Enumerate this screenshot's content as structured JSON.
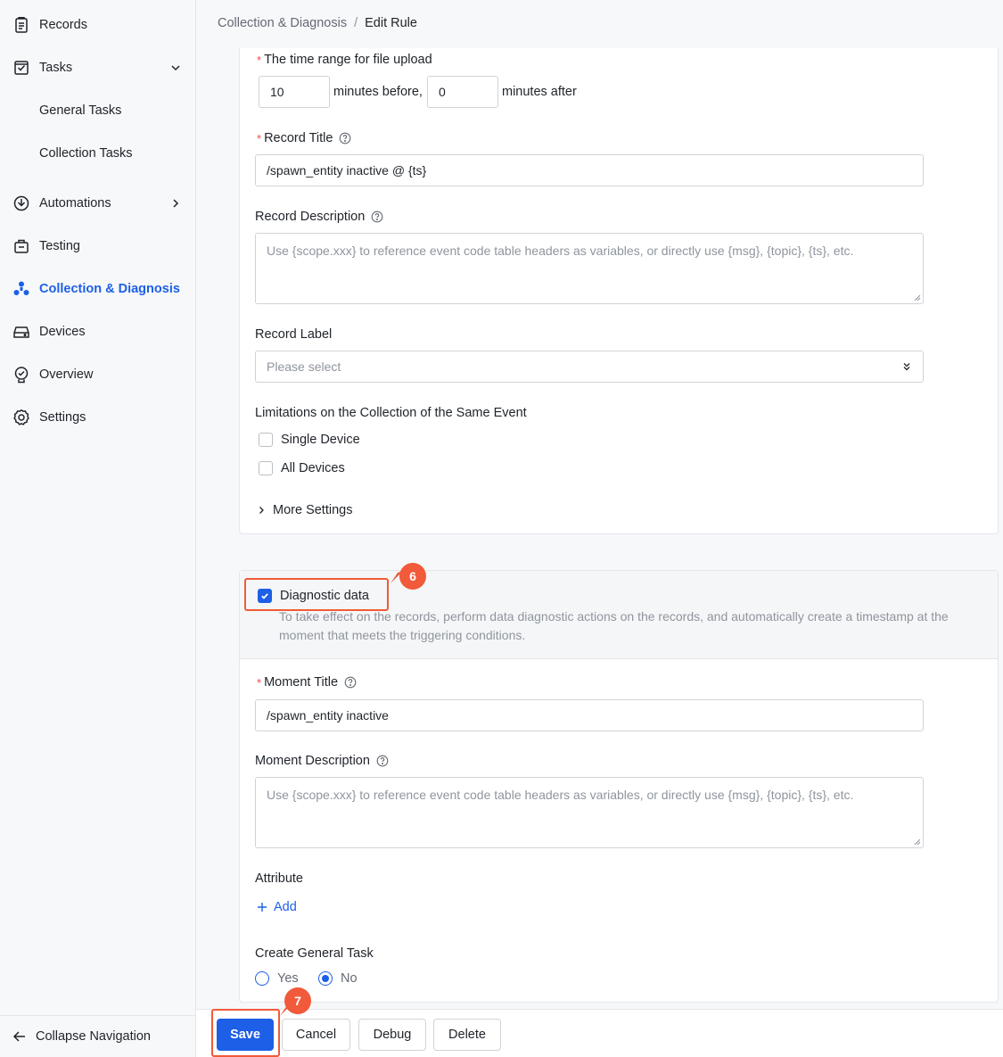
{
  "sidebar": {
    "items": [
      {
        "label": "Records",
        "icon": "records-icon"
      },
      {
        "label": "Tasks",
        "icon": "tasks-icon"
      },
      {
        "label": "General Tasks"
      },
      {
        "label": "Collection Tasks"
      },
      {
        "label": "Automations",
        "icon": "automations-icon"
      },
      {
        "label": "Testing",
        "icon": "testing-icon"
      },
      {
        "label": "Collection & Diagnosis",
        "icon": "collection-diagnosis-icon"
      },
      {
        "label": "Devices",
        "icon": "devices-icon"
      },
      {
        "label": "Overview",
        "icon": "overview-icon"
      },
      {
        "label": "Settings",
        "icon": "settings-icon"
      }
    ],
    "active_color": "#1d5fe6",
    "collapse_label": "Collapse Navigation"
  },
  "breadcrumb": {
    "parent": "Collection & Diagnosis",
    "separator": "/",
    "current": "Edit Rule"
  },
  "upload_range": {
    "label": "The time range for file upload",
    "before_value": "10",
    "before_text": "minutes before,",
    "after_value": "0",
    "after_text": "minutes after"
  },
  "record_title": {
    "label": "Record Title",
    "value": "/spawn_entity inactive @ {ts}"
  },
  "record_description": {
    "label": "Record Description",
    "placeholder": "Use {scope.xxx} to reference event code table headers as variables, or directly use {msg}, {topic}, {ts}, etc."
  },
  "record_label": {
    "label": "Record Label",
    "placeholder": "Please select"
  },
  "limitations": {
    "label": "Limitations on the Collection of the Same Event",
    "options": [
      {
        "label": "Single Device",
        "checked": false
      },
      {
        "label": "All Devices",
        "checked": false
      }
    ]
  },
  "more_settings": {
    "label": "More Settings"
  },
  "diagnostic": {
    "label": "Diagnostic data",
    "checked": true,
    "description": "To take effect on the records, perform data diagnostic actions on the records, and automatically create a timestamp at the moment that meets the triggering conditions."
  },
  "moment_title": {
    "label": "Moment Title",
    "value": "/spawn_entity inactive"
  },
  "moment_description": {
    "label": "Moment Description",
    "placeholder": "Use {scope.xxx} to reference event code table headers as variables, or directly use {msg}, {topic}, {ts}, etc."
  },
  "attribute": {
    "label": "Attribute",
    "add_label": "Add"
  },
  "general_task": {
    "label": "Create General Task",
    "options": [
      {
        "label": "Yes",
        "selected": false
      },
      {
        "label": "No",
        "selected": true
      }
    ]
  },
  "annotations": {
    "step6": "6",
    "step7": "7",
    "color": "#f15a3a"
  },
  "footer": {
    "save": "Save",
    "cancel": "Cancel",
    "debug": "Debug",
    "delete": "Delete"
  }
}
